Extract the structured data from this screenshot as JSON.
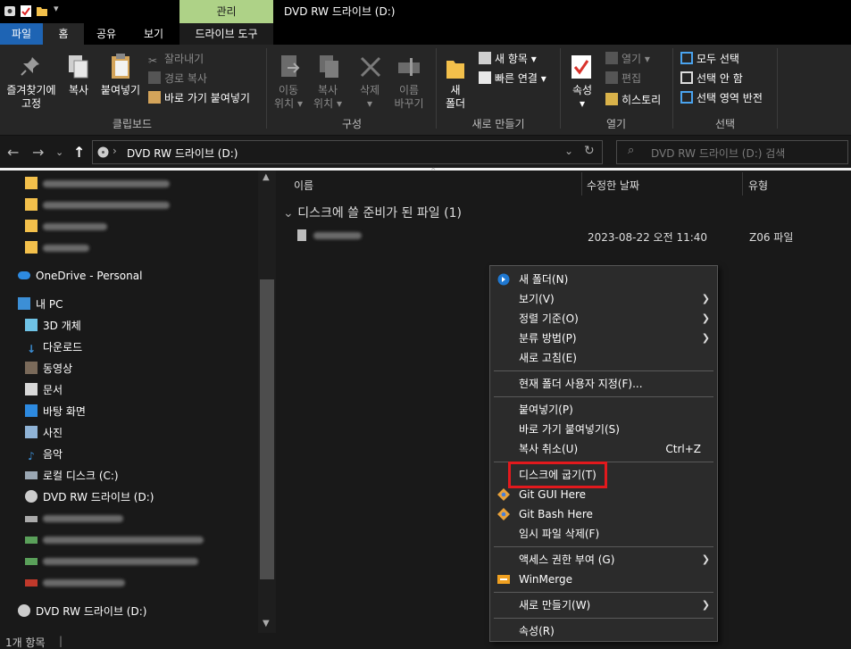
{
  "window": {
    "title": "DVD RW 드라이브 (D:)"
  },
  "ribbon_tabs": {
    "file": "파일",
    "home": "홈",
    "share": "공유",
    "view": "보기",
    "manage": "관리",
    "drive_tools": "드라이브 도구"
  },
  "ribbon": {
    "clipboard": {
      "pin_label_1": "즐겨찾기에",
      "pin_label_2": "고정",
      "copy": "복사",
      "paste": "붙여넣기",
      "cut": "잘라내기",
      "copy_path": "경로 복사",
      "paste_shortcut": "바로 가기 붙여넣기",
      "group": "클립보드"
    },
    "organize": {
      "move_1": "이동",
      "move_2": "위치",
      "copyto_1": "복사",
      "copyto_2": "위치",
      "delete": "삭제",
      "rename_1": "이름",
      "rename_2": "바꾸기",
      "group": "구성"
    },
    "new": {
      "folder_1": "새",
      "folder_2": "폴더",
      "new_item": "새 항목",
      "easy_access": "빠른 연결",
      "group": "새로 만들기"
    },
    "open": {
      "properties": "속성",
      "open": "열기",
      "edit": "편집",
      "history": "히스토리",
      "group": "열기"
    },
    "select": {
      "select_all": "모두 선택",
      "select_none": "선택 안 함",
      "invert": "선택 영역 반전",
      "group": "선택"
    }
  },
  "address": {
    "path": "DVD RW 드라이브 (D:)",
    "search_placeholder": "DVD RW 드라이브 (D:) 검색"
  },
  "nav": {
    "onedrive": "OneDrive - Personal",
    "this_pc": "내 PC",
    "objects3d": "3D 개체",
    "downloads": "다운로드",
    "videos": "동영상",
    "documents": "문서",
    "desktop": "바탕 화면",
    "pictures": "사진",
    "music": "음악",
    "local_disk": "로컬 디스크 (C:)",
    "dvd_drive": "DVD RW 드라이브 (D:)",
    "dvd_drive_bottom": "DVD RW 드라이브 (D:)"
  },
  "columns": {
    "name": "이름",
    "modified": "수정한 날짜",
    "type": "유형"
  },
  "group_header": "디스크에 쓸 준비가 된 파일 (1)",
  "file_row": {
    "date": "2023-08-22 오전 11:40",
    "type": "Z06 파일"
  },
  "status": {
    "count": "1개 항목"
  },
  "context_menu": {
    "new_folder": "새 폴더(N)",
    "view": "보기(V)",
    "sort": "정렬 기준(O)",
    "group_by": "분류 방법(P)",
    "refresh": "새로 고침(E)",
    "customize": "현재 폴더 사용자 지정(F)...",
    "paste": "붙여넣기(P)",
    "paste_shortcut": "바로 가기 붙여넣기(S)",
    "undo_copy": "복사 취소(U)",
    "undo_shortcut": "Ctrl+Z",
    "burn": "디스크에 굽기(T)",
    "git_gui": "Git GUI Here",
    "git_bash": "Git Bash Here",
    "delete_temp": "임시 파일 삭제(F)",
    "give_access": "액세스 권한 부여 (G)",
    "winmerge": "WinMerge",
    "new": "새로 만들기(W)",
    "properties": "속성(R)"
  },
  "colors": {
    "file_tab": "#1e64b4",
    "manage_tab": "#aed287",
    "highlight_box": "#e2191d"
  }
}
